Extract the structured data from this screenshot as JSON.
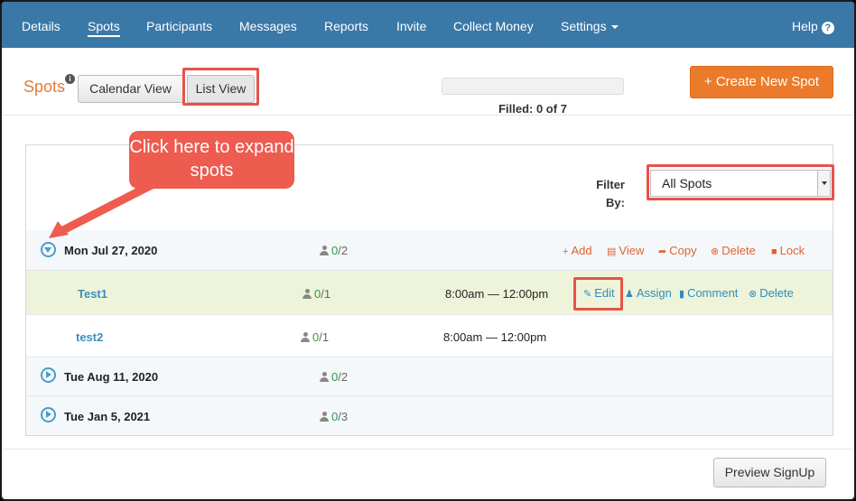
{
  "nav": {
    "items": [
      {
        "label": "Details"
      },
      {
        "label": "Spots"
      },
      {
        "label": "Participants"
      },
      {
        "label": "Messages"
      },
      {
        "label": "Reports"
      },
      {
        "label": "Invite"
      },
      {
        "label": "Collect Money"
      },
      {
        "label": "Settings"
      }
    ],
    "active": "Spots",
    "help_label": "Help",
    "help_badge": "?"
  },
  "header": {
    "title": "Spots",
    "info_badge": "i",
    "calendar_view_label": "Calendar View",
    "list_view_label": "List View",
    "filled_text": "Filled: 0 of 7",
    "filled_fraction": 0,
    "create_button_label": "+ Create New Spot"
  },
  "annotation": {
    "callout_text": "Click here to expand spots",
    "highlight_color": "#e8524a"
  },
  "filter": {
    "label": "Filter By:",
    "selected": "All Spots"
  },
  "dates": [
    {
      "date": "Mon Jul 27, 2020",
      "expanded": true,
      "filled": "0",
      "total": "/2",
      "actions": [
        "Add",
        "View",
        "Copy",
        "Delete",
        "Lock"
      ],
      "spots": [
        {
          "name": "Test1",
          "filled": "0",
          "total": "/1",
          "time": "8:00am — 12:00pm",
          "actions": [
            "Edit",
            "Assign",
            "Comment",
            "Delete"
          ]
        },
        {
          "name": "test2",
          "filled": "0",
          "total": "/1",
          "time": "8:00am — 12:00pm"
        }
      ]
    },
    {
      "date": "Tue Aug 11, 2020",
      "expanded": false,
      "filled": "0",
      "total": "/2"
    },
    {
      "date": "Tue Jan 5, 2021",
      "expanded": false,
      "filled": "0",
      "total": "/3"
    }
  ],
  "footer": {
    "preview_label": "Preview SignUp"
  },
  "colors": {
    "nav_bg": "#3a78a8",
    "accent_orange": "#ec7a2b",
    "link_blue": "#3a8fbf",
    "count_green": "#2e9a45"
  }
}
